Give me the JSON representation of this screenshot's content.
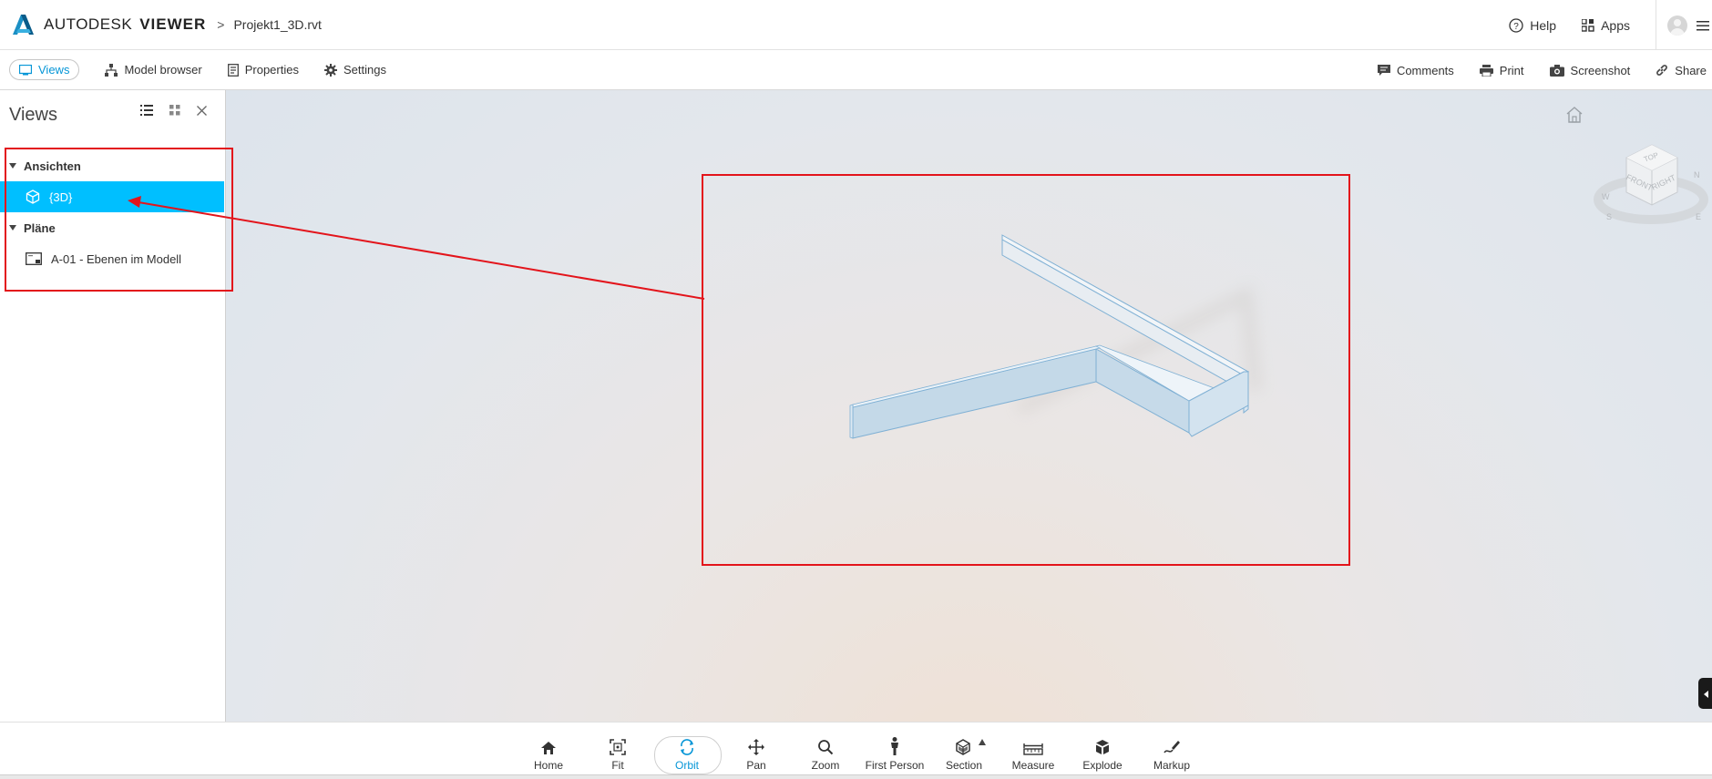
{
  "header": {
    "brand_name": "AUTODESK",
    "brand_product": "VIEWER",
    "breadcrumb_sep": ">",
    "filename": "Projekt1_3D.rvt",
    "help_label": "Help",
    "apps_label": "Apps"
  },
  "toolbar": {
    "views_label": "Views",
    "model_browser_label": "Model browser",
    "properties_label": "Properties",
    "settings_label": "Settings",
    "comments_label": "Comments",
    "print_label": "Print",
    "screenshot_label": "Screenshot",
    "share_label": "Share"
  },
  "panel": {
    "title": "Views",
    "groups": [
      {
        "label": "Ansichten",
        "items": [
          {
            "label": "{3D}",
            "icon": "cube-icon",
            "selected": true
          }
        ]
      },
      {
        "label": "Pläne",
        "items": [
          {
            "label": "A-01 - Ebenen im Modell",
            "icon": "sheet-icon",
            "selected": false
          }
        ]
      }
    ]
  },
  "viewcube": {
    "top": "TOP",
    "front": "FRONT",
    "right": "RIGHT",
    "compass": [
      "W",
      "N",
      "S",
      "E"
    ]
  },
  "bottom_toolbar": [
    {
      "label": "Home",
      "icon": "home-icon"
    },
    {
      "label": "Fit",
      "icon": "fit-icon"
    },
    {
      "label": "Orbit",
      "icon": "orbit-icon",
      "active": true
    },
    {
      "label": "Pan",
      "icon": "pan-icon"
    },
    {
      "label": "Zoom",
      "icon": "zoom-icon"
    },
    {
      "label": "First Person",
      "icon": "first-person-icon"
    },
    {
      "label": "Section",
      "icon": "section-icon"
    },
    {
      "label": "Measure",
      "icon": "measure-icon"
    },
    {
      "label": "Explode",
      "icon": "explode-icon"
    },
    {
      "label": "Markup",
      "icon": "markup-icon"
    }
  ],
  "colors": {
    "accent": "#0696d7",
    "selection": "#00bfff",
    "annotation": "#e3141b"
  }
}
